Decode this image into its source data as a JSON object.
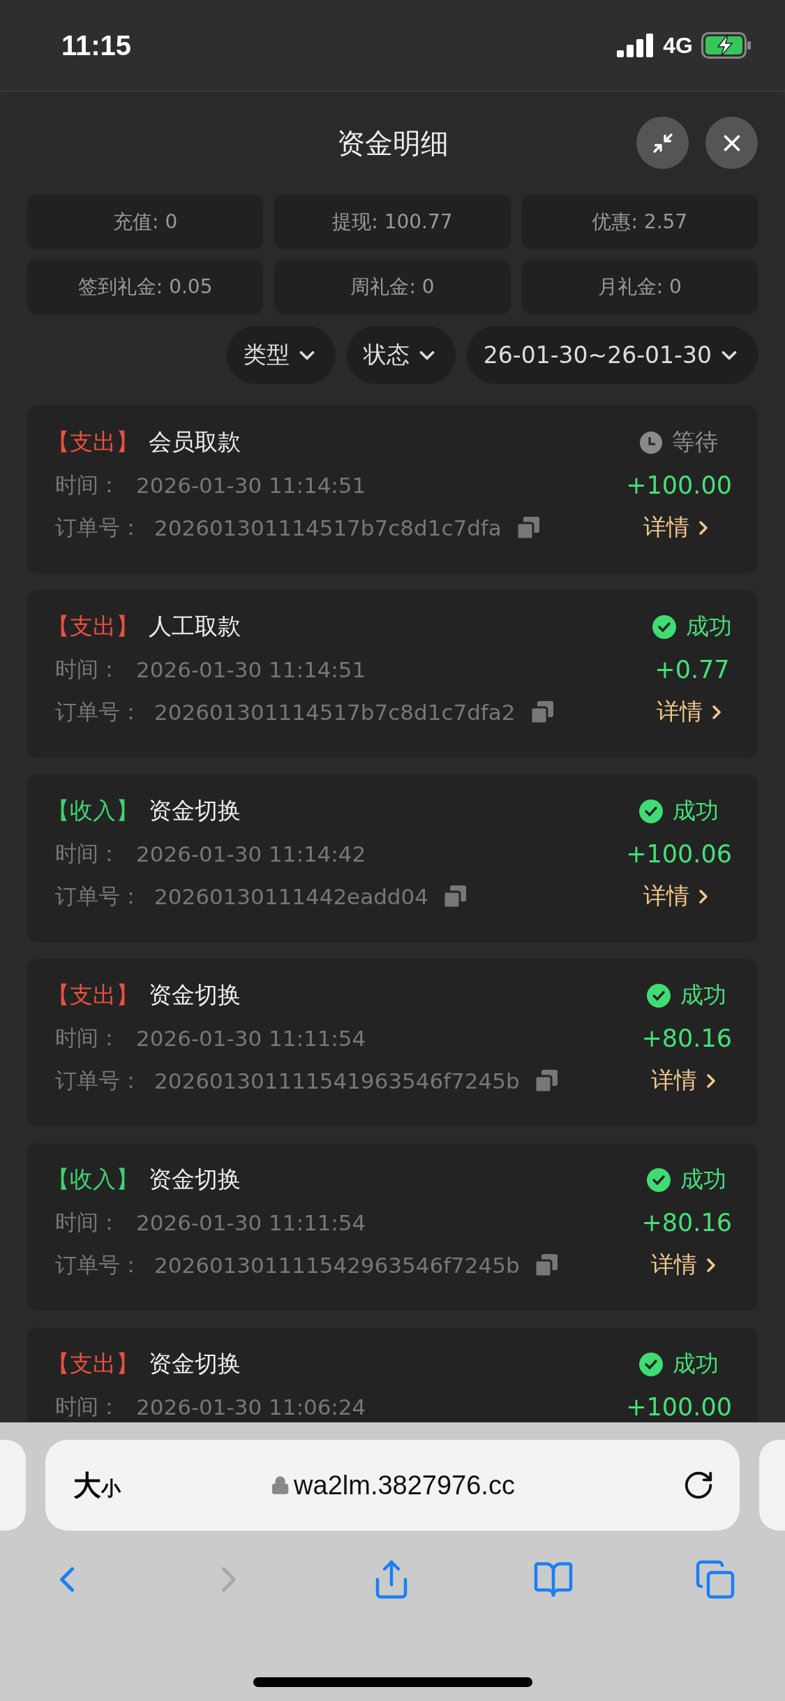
{
  "status_bar": {
    "time": "11:15",
    "network": "4G"
  },
  "panel": {
    "title": "资金明细"
  },
  "summary": [
    {
      "label": "充值: 0"
    },
    {
      "label": "提现: 100.77"
    },
    {
      "label": "优惠: 2.57"
    },
    {
      "label": "签到礼金: 0.05"
    },
    {
      "label": "周礼金: 0"
    },
    {
      "label": "月礼金: 0"
    }
  ],
  "filters": [
    {
      "label": "类型"
    },
    {
      "label": "状态"
    },
    {
      "label": "26-01-30~26-01-30"
    }
  ],
  "records": [
    {
      "kind": "expense",
      "tag": "【支出】",
      "title": "会员取款",
      "time_label": "时间：",
      "time": "2026-01-30 11:14:51",
      "order_label": "订单号：",
      "order_no": "202601301114517b7c8d1c7dfa",
      "status": {
        "kind": "pending",
        "label": "等待"
      },
      "amount": "+100.00",
      "detail": "详情"
    },
    {
      "kind": "expense",
      "tag": "【支出】",
      "title": "人工取款",
      "time_label": "时间：",
      "time": "2026-01-30 11:14:51",
      "order_label": "订单号：",
      "order_no": "202601301114517b7c8d1c7dfa2",
      "status": {
        "kind": "success",
        "label": "成功"
      },
      "amount": "+0.77",
      "detail": "详情"
    },
    {
      "kind": "income",
      "tag": "【收入】",
      "title": "资金切换",
      "time_label": "时间：",
      "time": "2026-01-30 11:14:42",
      "order_label": "订单号：",
      "order_no": "20260130111442eadd04",
      "status": {
        "kind": "success",
        "label": "成功"
      },
      "amount": "+100.06",
      "detail": "详情"
    },
    {
      "kind": "expense",
      "tag": "【支出】",
      "title": "资金切换",
      "time_label": "时间：",
      "time": "2026-01-30 11:11:54",
      "order_label": "订单号：",
      "order_no": "202601301111541963546f7245b",
      "status": {
        "kind": "success",
        "label": "成功"
      },
      "amount": "+80.16",
      "detail": "详情"
    },
    {
      "kind": "income",
      "tag": "【收入】",
      "title": "资金切换",
      "time_label": "时间：",
      "time": "2026-01-30 11:11:54",
      "order_label": "订单号：",
      "order_no": "202601301111542963546f7245b",
      "status": {
        "kind": "success",
        "label": "成功"
      },
      "amount": "+80.16",
      "detail": "详情"
    },
    {
      "kind": "expense",
      "tag": "【支出】",
      "title": "资金切换",
      "time_label": "时间：",
      "time": "2026-01-30 11:06:24",
      "status": {
        "kind": "success",
        "label": "成功"
      },
      "amount": "+100.00"
    }
  ],
  "browser": {
    "text_size_big": "大",
    "text_size_small": "小",
    "url": "wa2lm.3827976.cc",
    "back_disabled": false,
    "forward_disabled": true
  }
}
